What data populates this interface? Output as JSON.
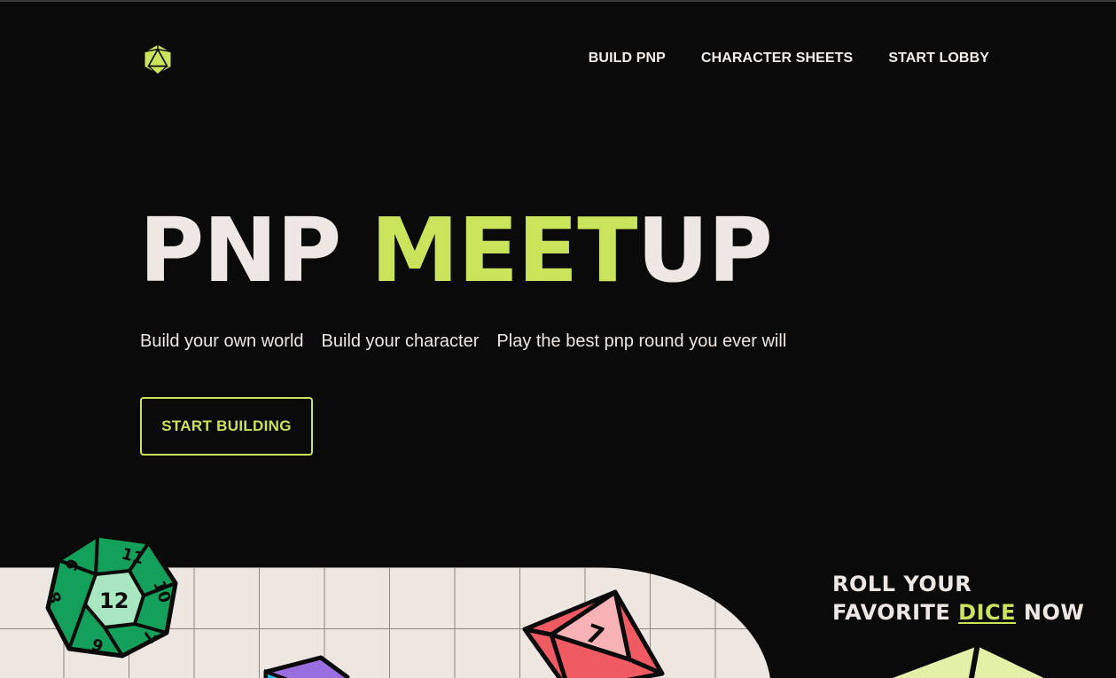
{
  "nav": {
    "logo_icon": "d20-icon",
    "items": [
      {
        "label": "BUILD PNP"
      },
      {
        "label": "CHARACTER SHEETS"
      },
      {
        "label": "START LOBBY"
      }
    ]
  },
  "hero": {
    "title_part1": "PNP ",
    "title_accent": "MEET",
    "title_part2": "UP",
    "taglines": [
      "Build your own world",
      "Build your character",
      "Play the best pnp round you ever will"
    ],
    "cta_label": "START BUILDING"
  },
  "roll_section": {
    "line1": "ROLL YOUR",
    "line2_start": "FAVORITE ",
    "line2_accent": "DICE",
    "line2_end": " NOW"
  },
  "dice": {
    "d12_numbers": [
      "11",
      "10",
      "7",
      "6",
      "8",
      "9",
      "12"
    ],
    "d8_number": "7"
  },
  "colors": {
    "background": "#0a0a0a",
    "accent": "#c9e35b",
    "text": "#eee7e3",
    "grid_panel": "#ede6e1"
  }
}
